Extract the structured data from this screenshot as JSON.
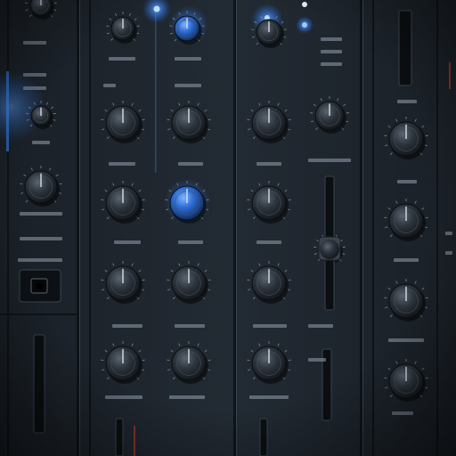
{
  "scene": {
    "subject": "mixing-console",
    "palette": {
      "panel": "#1d242c",
      "panel_light": "#26303a",
      "divider": "#0e1317",
      "knob_body": "#2a3038",
      "knob_highlight": "#5a6470",
      "led_blue": "#3b8cff",
      "led_glow": "#1f6dff",
      "tick": "#7f8a96"
    },
    "channel_strips": 5,
    "knobs_per_strip": 5,
    "blue_lit_knobs": 3,
    "faders": 3,
    "lit_leds": 4,
    "label_text": "illegible"
  }
}
